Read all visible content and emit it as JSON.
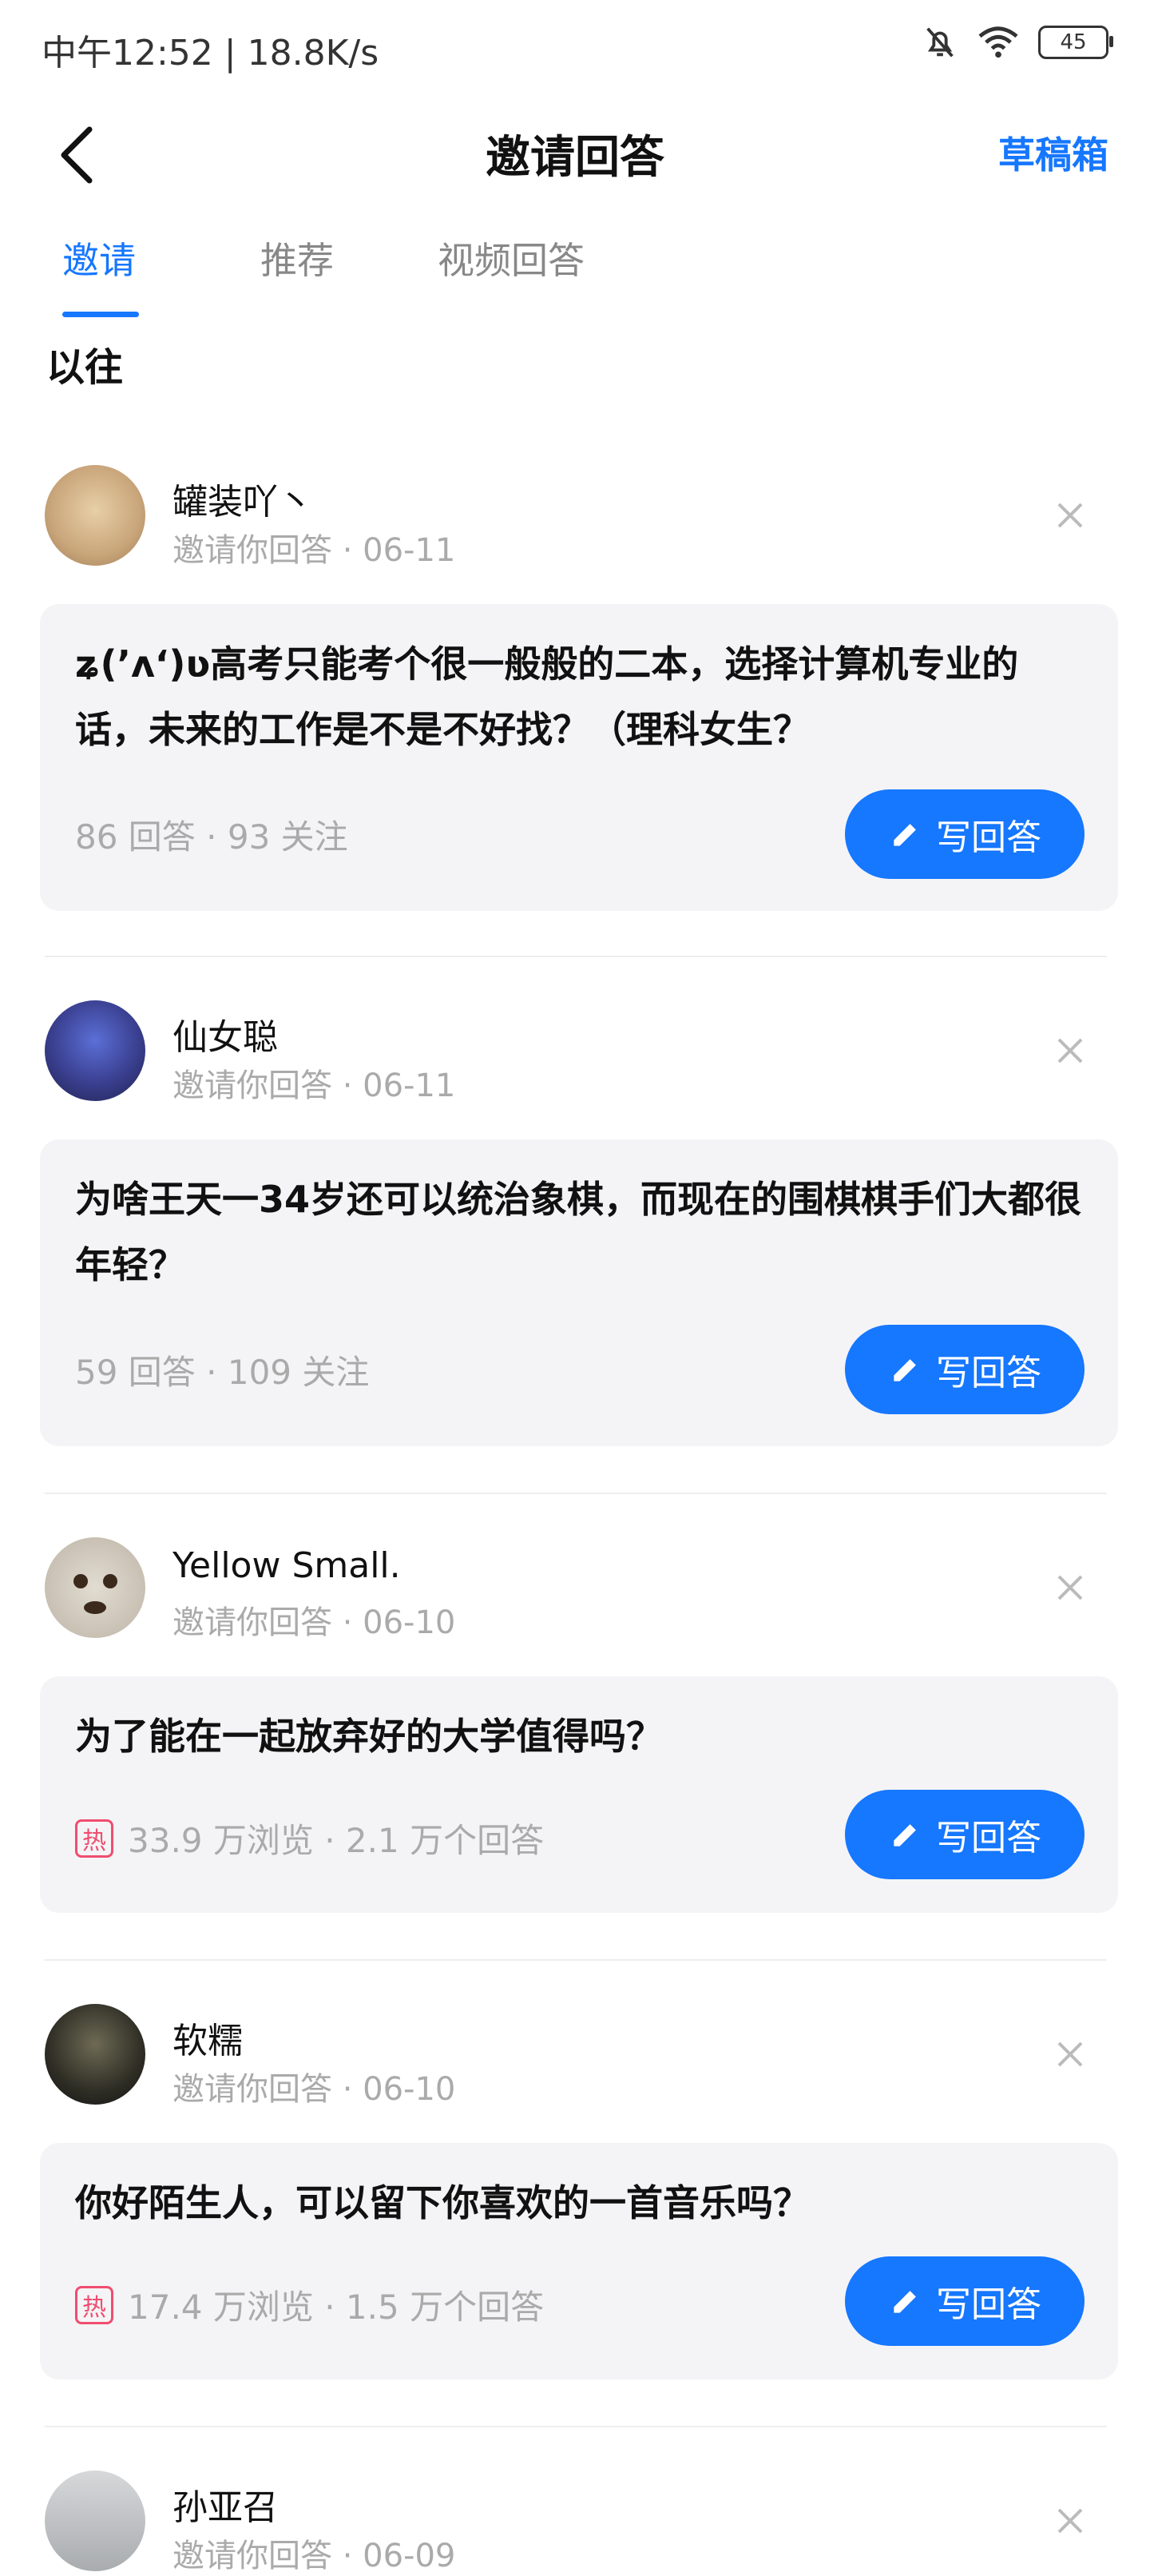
{
  "status_bar": {
    "time": "中午12:52 | 18.8K/s",
    "battery": "45",
    "icons": [
      "bell-off-icon",
      "wifi-icon",
      "battery-icon"
    ]
  },
  "nav": {
    "title": "邀请回答",
    "drafts": "草稿箱",
    "back_icon": "chevron-left-icon"
  },
  "tabs": [
    {
      "label": "邀请",
      "active": true
    },
    {
      "label": "推荐",
      "active": false
    },
    {
      "label": "视频回答",
      "active": false
    }
  ],
  "section_title": "以往",
  "answer_button_label": "写回答",
  "invites": [
    {
      "user": "罐装吖丶",
      "meta": "邀请你回答 · 06-11",
      "question": "ʑ(ʼʌʻ)ʋ高考只能考个很一般般的二本，选择计算机专业的话，未来的工作是不是不好找？（理科女生？",
      "stats": "86 回答 · 93 关注",
      "hot": false
    },
    {
      "user": "仙女聪",
      "meta": "邀请你回答 · 06-11",
      "question": "为啥王天一34岁还可以统治象棋，而现在的围棋棋手们大都很年轻？",
      "stats": "59 回答 · 109 关注",
      "hot": false
    },
    {
      "user": "Yellow Small.",
      "meta": "邀请你回答 · 06-10",
      "question": "为了能在一起放弃好的大学值得吗？",
      "stats": "33.9 万浏览 · 2.1 万个回答",
      "hot": true,
      "hot_label": "热"
    },
    {
      "user": "软糯",
      "meta": "邀请你回答 · 06-10",
      "question": "你好陌生人，可以留下你喜欢的一首音乐吗？",
      "stats": "17.4 万浏览 · 1.5 万个回答",
      "hot": true,
      "hot_label": "热"
    },
    {
      "user": "孙亚召",
      "meta": "邀请你回答 · 06-09"
    }
  ]
}
